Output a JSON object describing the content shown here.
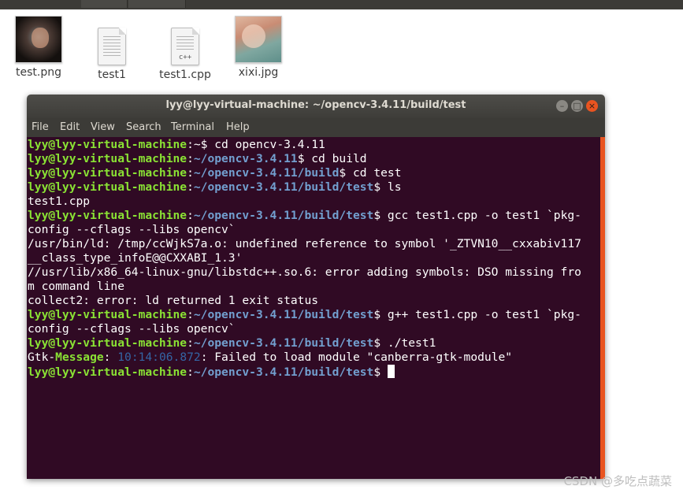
{
  "desktop": {
    "files": [
      {
        "name": "test.png",
        "icon": "image-thumbnail-icon"
      },
      {
        "name": "test1",
        "icon": "text-file-icon"
      },
      {
        "name": "test1.cpp",
        "icon": "cpp-source-file-icon",
        "badge": "c++"
      },
      {
        "name": "xixi.jpg",
        "icon": "image-thumbnail-icon"
      }
    ]
  },
  "terminal": {
    "title": "lyy@lyy-virtual-machine: ~/opencv-3.4.11/build/test",
    "window_buttons": {
      "minimize": "–",
      "maximize": "□",
      "close": "×"
    },
    "menu": [
      "File",
      "Edit",
      "View",
      "Search",
      "Terminal",
      "Help"
    ],
    "colors": {
      "background": "#300a24",
      "user": "#8ae234",
      "path": "#729fcf",
      "accent": "#e95420"
    },
    "lines": [
      [
        {
          "c": "g",
          "t": "lyy@lyy-virtual-machine"
        },
        {
          "c": "w",
          "t": ":~$ cd opencv-3.4.11"
        }
      ],
      [
        {
          "c": "g",
          "t": "lyy@lyy-virtual-machine"
        },
        {
          "c": "w",
          "t": ":"
        },
        {
          "c": "b",
          "t": "~/opencv-3.4.11"
        },
        {
          "c": "w",
          "t": "$ cd build"
        }
      ],
      [
        {
          "c": "g",
          "t": "lyy@lyy-virtual-machine"
        },
        {
          "c": "w",
          "t": ":"
        },
        {
          "c": "b",
          "t": "~/opencv-3.4.11/build"
        },
        {
          "c": "w",
          "t": "$ cd test"
        }
      ],
      [
        {
          "c": "g",
          "t": "lyy@lyy-virtual-machine"
        },
        {
          "c": "w",
          "t": ":"
        },
        {
          "c": "b",
          "t": "~/opencv-3.4.11/build/test"
        },
        {
          "c": "w",
          "t": "$ ls"
        }
      ],
      [
        {
          "c": "w",
          "t": "test1.cpp"
        }
      ],
      [
        {
          "c": "g",
          "t": "lyy@lyy-virtual-machine"
        },
        {
          "c": "w",
          "t": ":"
        },
        {
          "c": "b",
          "t": "~/opencv-3.4.11/build/test"
        },
        {
          "c": "w",
          "t": "$ gcc test1.cpp -o test1 `pkg-"
        }
      ],
      [
        {
          "c": "w",
          "t": "config --cflags --libs opencv`"
        }
      ],
      [
        {
          "c": "w",
          "t": "/usr/bin/ld: /tmp/ccWjkS7a.o: undefined reference to symbol '_ZTVN10__cxxabiv117"
        }
      ],
      [
        {
          "c": "w",
          "t": "__class_type_infoE@@CXXABI_1.3'"
        }
      ],
      [
        {
          "c": "w",
          "t": "//usr/lib/x86_64-linux-gnu/libstdc++.so.6: error adding symbols: DSO missing fro"
        }
      ],
      [
        {
          "c": "w",
          "t": "m command line"
        }
      ],
      [
        {
          "c": "w",
          "t": "collect2: error: ld returned 1 exit status"
        }
      ],
      [
        {
          "c": "g",
          "t": "lyy@lyy-virtual-machine"
        },
        {
          "c": "w",
          "t": ":"
        },
        {
          "c": "b",
          "t": "~/opencv-3.4.11/build/test"
        },
        {
          "c": "w",
          "t": "$ g++ test1.cpp -o test1 `pkg-"
        }
      ],
      [
        {
          "c": "w",
          "t": "config --cflags --libs opencv`"
        }
      ],
      [
        {
          "c": "g",
          "t": "lyy@lyy-virtual-machine"
        },
        {
          "c": "w",
          "t": ":"
        },
        {
          "c": "b",
          "t": "~/opencv-3.4.11/build/test"
        },
        {
          "c": "w",
          "t": "$ ./test1"
        }
      ],
      [
        {
          "c": "w",
          "t": "Gtk-"
        },
        {
          "c": "g",
          "t": "Message"
        },
        {
          "c": "w",
          "t": ": "
        },
        {
          "c": "t",
          "t": "10:14:06.872"
        },
        {
          "c": "w",
          "t": ": Failed to load module \"canberra-gtk-module\""
        }
      ],
      [
        {
          "c": "g",
          "t": "lyy@lyy-virtual-machine"
        },
        {
          "c": "w",
          "t": ":"
        },
        {
          "c": "b",
          "t": "~/opencv-3.4.11/build/test"
        },
        {
          "c": "w",
          "t": "$ "
        }
      ]
    ]
  },
  "watermark": "CSDN @多吃点蔬菜"
}
